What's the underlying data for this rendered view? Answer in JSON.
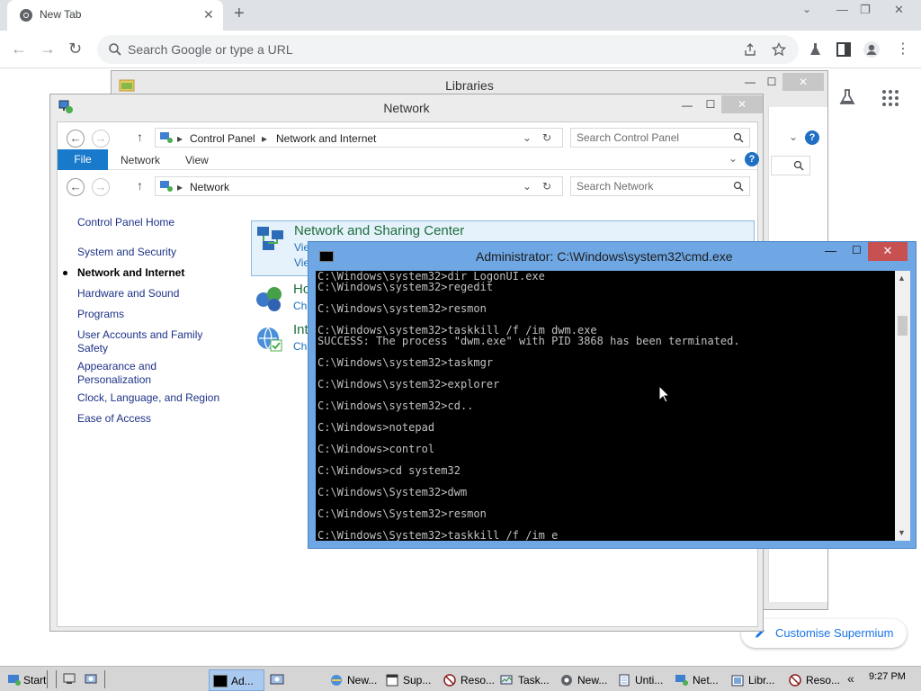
{
  "chrome": {
    "tab_title": "New Tab",
    "omnibox_placeholder": "Search Google or type a URL",
    "customise_label": "Customise Supermium"
  },
  "libraries_window": {
    "title": "Libraries"
  },
  "network_window": {
    "title": "Network",
    "breadcrumb": [
      "Control Panel",
      "Network and Internet"
    ],
    "search_cp_placeholder": "Search Control Panel",
    "ribbon_tabs": [
      "File",
      "Network",
      "View"
    ],
    "nav_location": "Network",
    "search_net_placeholder": "Search Network",
    "cp_nav": [
      "Control Panel Home",
      "System and Security",
      "Network and Internet",
      "Hardware and Sound",
      "Programs",
      "User Accounts and Family Safety",
      "Appearance and Personalization",
      "Clock, Language, and Region",
      "Ease of Access"
    ],
    "categories": [
      {
        "title": "Network and Sharing Center",
        "sub1": "Vie",
        "sub2": "Vie"
      },
      {
        "title": "Ho",
        "sub1": "Cho"
      },
      {
        "title": "Int",
        "sub1": "Ch"
      }
    ]
  },
  "cmd_window": {
    "title": "Administrator: C:\\Windows\\system32\\cmd.exe",
    "lines": [
      "C:\\Windows\\system32>dir LogonUI.exe",
      "C:\\Windows\\system32>regedit",
      "",
      "C:\\Windows\\system32>resmon",
      "",
      "C:\\Windows\\system32>taskkill /f /im dwm.exe",
      "SUCCESS: The process \"dwm.exe\" with PID 3868 has been terminated.",
      "",
      "C:\\Windows\\system32>taskmgr",
      "",
      "C:\\Windows\\system32>explorer",
      "",
      "C:\\Windows\\system32>cd..",
      "",
      "C:\\Windows>notepad",
      "",
      "C:\\Windows>control",
      "",
      "C:\\Windows>cd system32",
      "",
      "C:\\Windows\\System32>dwm",
      "",
      "C:\\Windows\\System32>resmon",
      "",
      "C:\\Windows\\System32>taskkill /f /im e"
    ]
  },
  "taskbar": {
    "start_label": "Start",
    "buttons": [
      "Ad...",
      "New...",
      "Sup...",
      "Reso...",
      "Task...",
      "New...",
      "Unti...",
      "Net...",
      "Libr...",
      "Reso..."
    ],
    "tray_chevron": "«",
    "clock": "9:27 PM"
  },
  "colors": {
    "chrome_tabbar": "#dee1e6",
    "ribbon_file_tab": "#1979ca",
    "cmd_frame": "#6ea7e3",
    "cmd_close": "#c75050",
    "category_title": "#1e6e3c",
    "nav_link": "#1e3287"
  }
}
